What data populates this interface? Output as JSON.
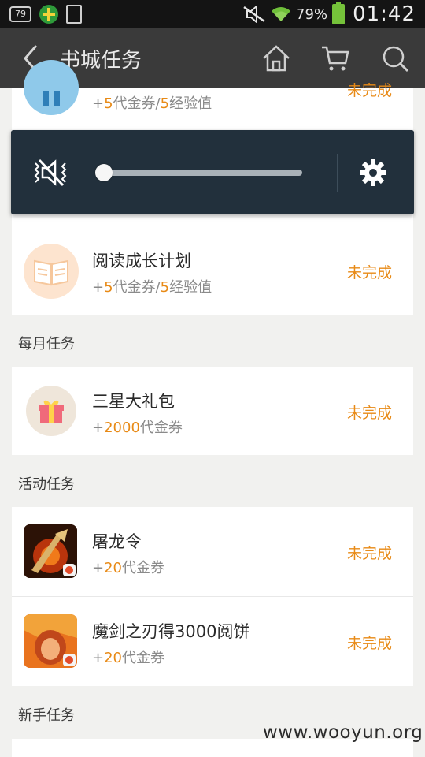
{
  "status_bar": {
    "notif_badge": "79",
    "battery_pct": "79%",
    "time": "01:42"
  },
  "header": {
    "title": "书城任务"
  },
  "top_task": {
    "reward_num1": "5",
    "reward_label1": "代金券/",
    "reward_num2": "5",
    "reward_label2": "经验值",
    "status": "未完成"
  },
  "volume": {
    "level": 0
  },
  "tasks_section1": [
    {
      "title": "阅读成长计划",
      "reward_num1": "5",
      "reward_label1": "代金券/",
      "reward_num2": "5",
      "reward_label2": "经验值",
      "status": "未完成"
    }
  ],
  "monthly": {
    "section_title": "每月任务",
    "items": [
      {
        "title": "三星大礼包",
        "reward_num": "2000",
        "reward_label": "代金券",
        "status": "未完成"
      }
    ]
  },
  "activity": {
    "section_title": "活动任务",
    "items": [
      {
        "title": "屠龙令",
        "reward_num": "20",
        "reward_label": "代金券",
        "status": "未完成"
      },
      {
        "title": "魔剑之刃得3000阅饼",
        "reward_num": "20",
        "reward_label": "代金券",
        "status": "未完成"
      }
    ]
  },
  "newbie": {
    "section_title": "新手任务"
  },
  "watermark": "www.wooyun.org",
  "colors": {
    "accent": "#e88a16",
    "header_bg": "#3a3a3a",
    "volume_bg": "#22303c"
  }
}
